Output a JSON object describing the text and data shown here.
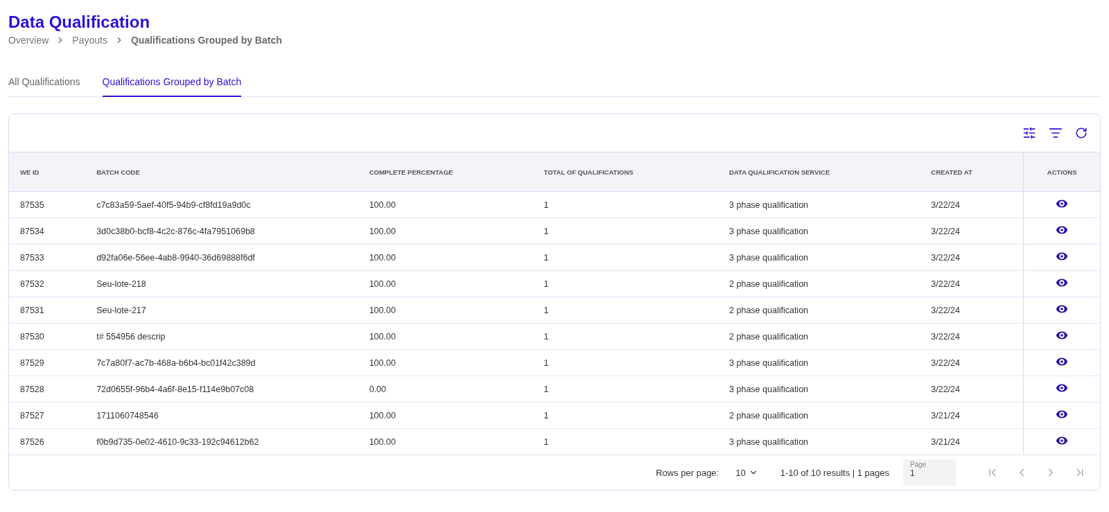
{
  "title": "Data Qualification",
  "breadcrumbs": [
    "Overview",
    "Payouts",
    "Qualifications Grouped by Batch"
  ],
  "tabs": [
    {
      "label": "All Qualifications",
      "selected": false
    },
    {
      "label": "Qualifications Grouped by Batch",
      "selected": true
    }
  ],
  "table": {
    "columns": [
      "WE ID",
      "BATCH CODE",
      "COMPLETE PERCENTAGE",
      "TOTAL OF QUALIFICATIONS",
      "DATA QUALIFICATION SERVICE",
      "CREATED AT",
      "ACTIONS"
    ],
    "rows": [
      [
        "87535",
        "c7c83a59-5aef-40f5-94b9-cf8fd19a9d0c",
        "100.00",
        "1",
        "3 phase qualification",
        "3/22/24"
      ],
      [
        "87534",
        "3d0c38b0-bcf8-4c2c-876c-4fa7951069b8",
        "100.00",
        "1",
        "3 phase qualification",
        "3/22/24"
      ],
      [
        "87533",
        "d92fa06e-56ee-4ab8-9940-36d69888f6df",
        "100.00",
        "1",
        "3 phase qualification",
        "3/22/24"
      ],
      [
        "87532",
        "Seu-lote-218",
        "100.00",
        "1",
        "2 phase qualification",
        "3/22/24"
      ],
      [
        "87531",
        "Seu-lote-217",
        "100.00",
        "1",
        "2 phase qualification",
        "3/22/24"
      ],
      [
        "87530",
        "t# 554956 descrip",
        "100.00",
        "1",
        "2 phase qualification",
        "3/22/24"
      ],
      [
        "87529",
        "7c7a80f7-ac7b-468a-b6b4-bc01f42c389d",
        "100.00",
        "1",
        "3 phase qualification",
        "3/22/24"
      ],
      [
        "87528",
        "72d0655f-96b4-4a6f-8e15-f114e9b07c08",
        "0.00",
        "1",
        "3 phase qualification",
        "3/22/24"
      ],
      [
        "87527",
        "1711060748546",
        "100.00",
        "1",
        "2 phase qualification",
        "3/21/24"
      ],
      [
        "87526",
        "f0b9d735-0e02-4610-9c33-192c94612b62",
        "100.00",
        "1",
        "3 phase qualification",
        "3/21/24"
      ]
    ]
  },
  "pagination": {
    "rows_per_page_label": "Rows per page:",
    "rows_per_page": "10",
    "summary": "1-10 of 10 results | 1 pages",
    "page_label": "Page",
    "page_value": "1",
    "nav": [
      {
        "kind": "first",
        "disabled": true
      },
      {
        "kind": "prev",
        "disabled": true
      },
      {
        "kind": "next",
        "disabled": true
      },
      {
        "kind": "last",
        "disabled": true
      }
    ]
  }
}
